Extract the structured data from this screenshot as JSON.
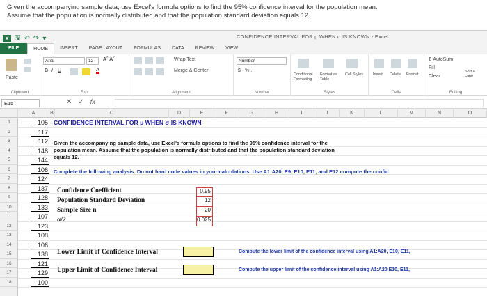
{
  "question": {
    "line1": "Given the accompanying sample data, use Excel's formula options to find the 95% confidence interval for the population mean.",
    "line2": "Assume that the population is normally distributed and that the population standard deviation equals 12."
  },
  "window": {
    "title": "CONFIDENCE INTERVAL FOR μ WHEN σ IS KNOWN - Excel"
  },
  "tabs": [
    "FILE",
    "HOME",
    "INSERT",
    "PAGE LAYOUT",
    "FORMULAS",
    "DATA",
    "REVIEW",
    "VIEW"
  ],
  "ribbon": {
    "paste": "Paste",
    "clipboard": "Clipboard",
    "font_name": "Arial",
    "font_size": "12",
    "font_group": "Font",
    "bold": "B",
    "italic": "I",
    "underline": "U",
    "wrap_text": "Wrap Text",
    "merge_center": "Merge & Center",
    "alignment": "Alignment",
    "number_format": "Number",
    "currency": "$ - % ,",
    "number_group": "Number",
    "conditional": "Conditional Formatting",
    "format_table": "Format as Table",
    "cell_styles": "Cell Styles",
    "styles_group": "Styles",
    "insert": "Insert",
    "delete": "Delete",
    "format": "Format",
    "cells_group": "Cells",
    "autosum": "Σ AutoSum",
    "fill": "Fill",
    "clear": "Clear",
    "sort": "Sort & Filter",
    "editing_group": "Editing"
  },
  "formula_bar": {
    "name_box": "E15",
    "fx": "fx"
  },
  "columns": [
    "A",
    "B",
    "C",
    "D",
    "E",
    "F",
    "G",
    "H",
    "I",
    "J",
    "K",
    "L",
    "M",
    "N",
    "O"
  ],
  "rows": [
    "1",
    "2",
    "3",
    "4",
    "5",
    "6",
    "7",
    "8",
    "9",
    "10",
    "11",
    "12",
    "13",
    "14",
    "15",
    "16",
    "17",
    "18"
  ],
  "sheet": {
    "col_a": [
      "105",
      "117",
      "112",
      "148",
      "144",
      "106",
      "124",
      "137",
      "128",
      "133",
      "107",
      "123",
      "108",
      "106",
      "138",
      "121",
      "129",
      "100"
    ],
    "title": "CONFIDENCE INTERVAL FOR μ WHEN σ IS KNOWN",
    "given_1": "Given the accompanying sample data, use Excel's formula options to find the 95% confidence interval for the",
    "given_2": "population mean. Assume that the population is normally distributed and that the population standard deviation",
    "given_3": "equals 12.",
    "complete": "Complete the following analysis. Do not hard code values in your calculations. Use A1:A20, E9, E10, E11, and E12 compute the confid",
    "conf_coef_label": "Confidence Coefficient",
    "conf_coef_value": "0.95",
    "pop_sd_label": "Population Standard Deviation",
    "pop_sd_value": "12",
    "sample_size_label": "Sample Size n",
    "sample_size_value": "20",
    "alpha_label": "α/2",
    "alpha_value": "0.025",
    "lower_label": "Lower Limit of Confidence Interval",
    "upper_label": "Upper Limit of Confidence Interval",
    "lower_instr": "Compute the lower limit of the confidence interval using A1:A20, E10, E11,",
    "upper_instr": "Compute the upper limit of the confidence interval using A1:A20,E10, E11,"
  }
}
